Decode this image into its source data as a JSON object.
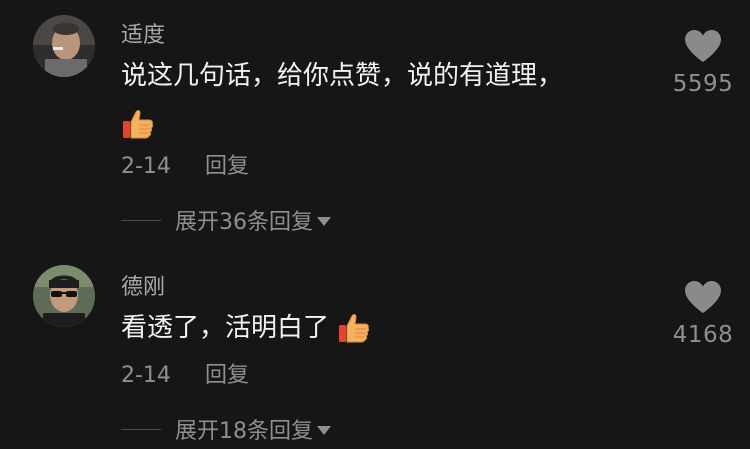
{
  "comments": [
    {
      "username": "适度",
      "text": "说这几句话，给你点赞，说的有道理，",
      "emoji": "thumbs-up-icon",
      "date": "2-14",
      "reply_label": "回复",
      "expand_label": "展开36条回复",
      "likes": "5595"
    },
    {
      "username": "德刚",
      "text": "看透了，活明白了",
      "emoji": "thumbs-up-icon",
      "date": "2-14",
      "reply_label": "回复",
      "expand_label": "展开18条回复",
      "likes": "4168"
    }
  ],
  "colors": {
    "background": "#161616",
    "text_primary": "#f2f2f2",
    "text_secondary": "#8f8f8f",
    "heart": "#8a8a8a",
    "thumb": "#f5b160"
  }
}
